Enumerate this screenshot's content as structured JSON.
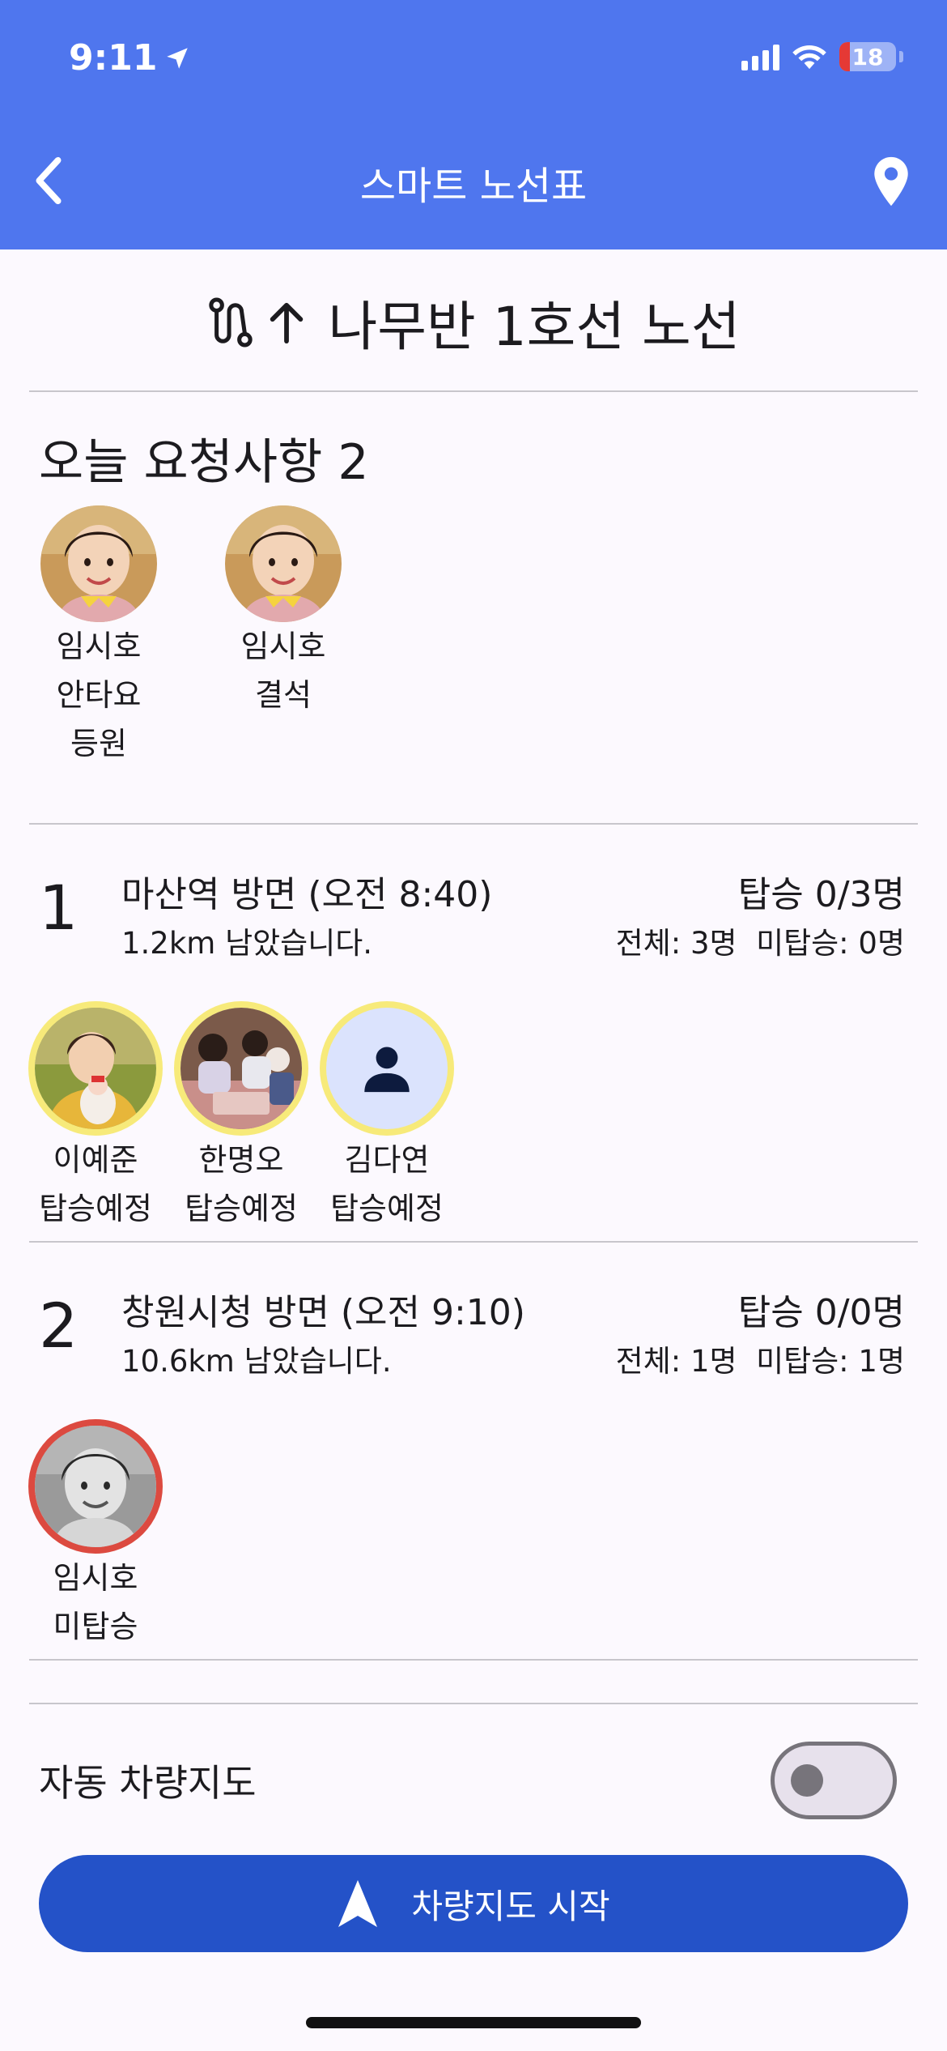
{
  "status_bar": {
    "time": "9:11",
    "battery": "18"
  },
  "nav": {
    "title": "스마트 노선표"
  },
  "route": {
    "title": "나무반 1호선 노선"
  },
  "requests": {
    "title": "오늘 요청사항 2",
    "items": [
      {
        "lines": [
          "임시호",
          "안타요",
          "등원"
        ]
      },
      {
        "lines": [
          "임시호",
          "결석"
        ]
      }
    ]
  },
  "stops": [
    {
      "number": "1",
      "name": "마산역 방면 (오전 8:40)",
      "distance": "1.2km 남았습니다.",
      "boarding": "탑승 0/3명",
      "stats": "전체: 3명  미탑승: 0명",
      "riders": [
        {
          "name": "이예준",
          "status": "탑승예정",
          "ring": "yellow",
          "photo": "photo-child"
        },
        {
          "name": "한명오",
          "status": "탑승예정",
          "ring": "yellow",
          "photo": "photo-classroom"
        },
        {
          "name": "김다연",
          "status": "탑승예정",
          "ring": "yellow",
          "photo": "person-icon"
        }
      ]
    },
    {
      "number": "2",
      "name": "창원시청 방면 (오전 9:10)",
      "distance": "10.6km 남았습니다.",
      "boarding": "탑승 0/0명",
      "stats": "전체: 1명  미탑승: 1명",
      "riders": [
        {
          "name": "임시호",
          "status": "미탑승",
          "ring": "red",
          "photo": "photo-child-gray"
        }
      ]
    }
  ],
  "auto_map": {
    "label": "자동 차량지도",
    "enabled": false
  },
  "start_button": {
    "label": "차량지도 시작"
  },
  "colors": {
    "header": "#4f76ee",
    "button": "#2452c8",
    "ring_pending": "#f7ea7a",
    "ring_missed": "#dc4a40"
  }
}
